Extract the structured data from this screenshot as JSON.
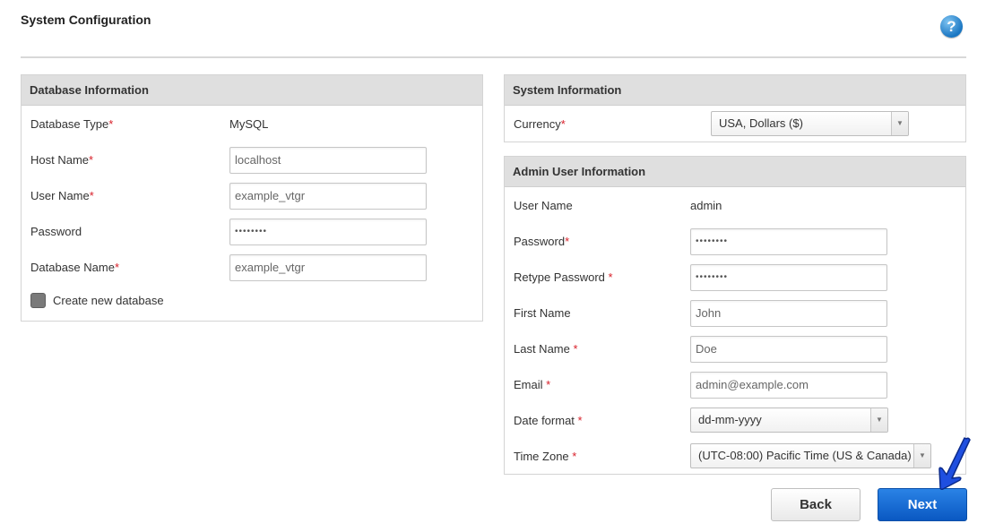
{
  "page": {
    "title": "System Configuration"
  },
  "help": {
    "icon": "help-icon",
    "glyph": "?"
  },
  "database": {
    "title": "Database Information",
    "type_label": "Database Type",
    "type_value": "MySQL",
    "host_label": "Host Name",
    "host_value": "localhost",
    "user_label": "User Name",
    "user_value": "example_vtgr",
    "password_label": "Password",
    "password_value": "••••••••",
    "dbname_label": "Database Name",
    "dbname_value": "example_vtgr",
    "create_label": "Create new database"
  },
  "system": {
    "title": "System Information",
    "currency_label": "Currency",
    "currency_value": "USA, Dollars ($)"
  },
  "admin": {
    "title": "Admin User Information",
    "username_label": "User Name",
    "username_value": "admin",
    "password_label": "Password",
    "password_value": "••••••••",
    "retype_label": "Retype Password",
    "retype_value": "••••••••",
    "firstname_label": "First Name",
    "firstname_value": "John",
    "lastname_label": "Last Name",
    "lastname_value": "Doe",
    "email_label": "Email",
    "email_value": "admin@example.com",
    "dateformat_label": "Date format",
    "dateformat_value": "dd-mm-yyyy",
    "timezone_label": "Time Zone",
    "timezone_value": "(UTC-08:00) Pacific Time (US & Canada)"
  },
  "required_marker": "*",
  "buttons": {
    "back": "Back",
    "next": "Next"
  },
  "colors": {
    "accent": "#0a58c2",
    "required": "#d8202a",
    "arrow": "#1f4fe0"
  }
}
